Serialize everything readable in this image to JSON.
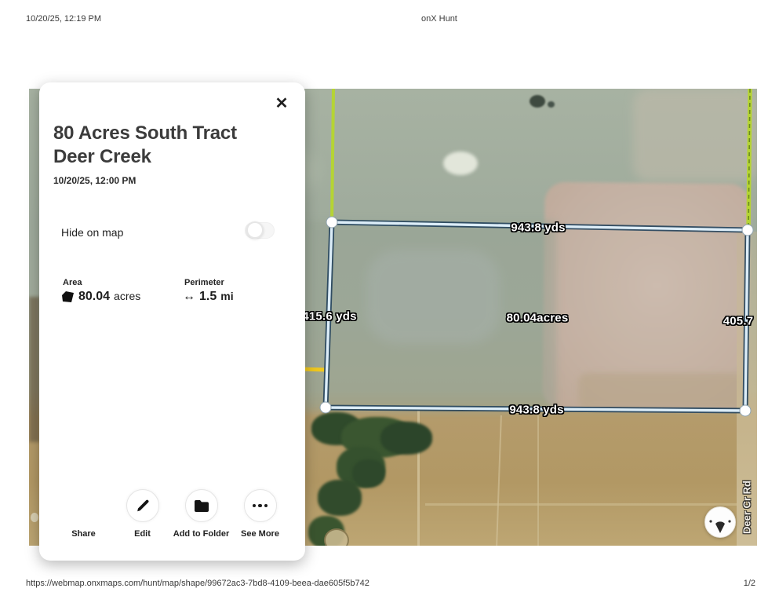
{
  "header": {
    "datetime": "10/20/25, 12:19 PM",
    "title": "onX Hunt"
  },
  "card": {
    "close": "✕",
    "title": "80 Acres South Tract Deer Creek",
    "timestamp": "10/20/25, 12:00 PM",
    "hide_on_map": "Hide on map",
    "area": {
      "label": "Area",
      "value": "80.04",
      "unit": "acres"
    },
    "perimeter": {
      "label": "Perimeter",
      "arrow": "↔",
      "value": "1.5",
      "unit": "mi"
    },
    "actions": [
      {
        "label": "Share"
      },
      {
        "label": "Edit"
      },
      {
        "label": "Add to Folder"
      },
      {
        "label": "See More"
      }
    ]
  },
  "map": {
    "measurements": {
      "top_edge": "943.8 yds",
      "bottom_edge": "943.8 yds",
      "left_edge": "415.6 yds",
      "right_edge": "405.7",
      "area": "80.04acres"
    },
    "road_label": "Deer Cr Rd",
    "colors": {
      "shape_line_casing": "#24425c",
      "shape_line": "#dcedf8",
      "road_green": "#b5d434",
      "field_green": "#a2ae9e",
      "field_tan": "#b89e6d",
      "patch_pink": "#c7b3a8"
    }
  },
  "footer": {
    "url": "https://webmap.onxmaps.com/hunt/map/shape/99672ac3-7bd8-4109-beea-dae605f5b742",
    "page": "1/2"
  }
}
